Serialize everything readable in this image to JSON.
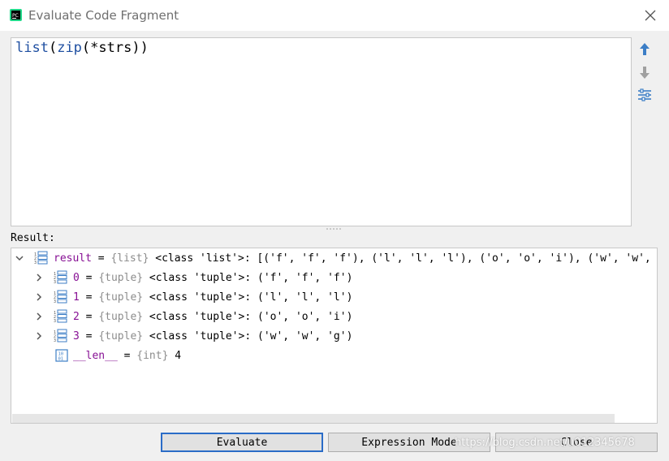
{
  "window": {
    "title": "Evaluate Code Fragment"
  },
  "editor": {
    "code_fn1": "list",
    "code_p1": "(",
    "code_fn2": "zip",
    "code_rest": "(*strs))"
  },
  "result": {
    "label": "Result:",
    "rows": [
      {
        "name": "result",
        "eq": " = ",
        "type": "{list}",
        "value": " <class 'list'>: [('f', 'f', 'f'), ('l', 'l', 'l'), ('o', 'o', 'i'), ('w', 'w', 'g')]"
      },
      {
        "name": "0",
        "eq": " = ",
        "type": "{tuple}",
        "value": " <class 'tuple'>: ('f', 'f', 'f')"
      },
      {
        "name": "1",
        "eq": " = ",
        "type": "{tuple}",
        "value": " <class 'tuple'>: ('l', 'l', 'l')"
      },
      {
        "name": "2",
        "eq": " = ",
        "type": "{tuple}",
        "value": " <class 'tuple'>: ('o', 'o', 'i')"
      },
      {
        "name": "3",
        "eq": " = ",
        "type": "{tuple}",
        "value": " <class 'tuple'>: ('w', 'w', 'g')"
      },
      {
        "name": "__len__",
        "eq": " = ",
        "type": "{int}",
        "value": " 4"
      }
    ]
  },
  "buttons": {
    "evaluate": "Evaluate",
    "expression_mode": "Expression Mode",
    "close": "Close"
  },
  "watermark": "https://blog.csdn.net/u012345678",
  "colors": {
    "accent": "#2a6cc7",
    "variable_name": "#871094",
    "type_hint": "#8c8c8c",
    "keyword_fn": "#1f4fa1"
  }
}
